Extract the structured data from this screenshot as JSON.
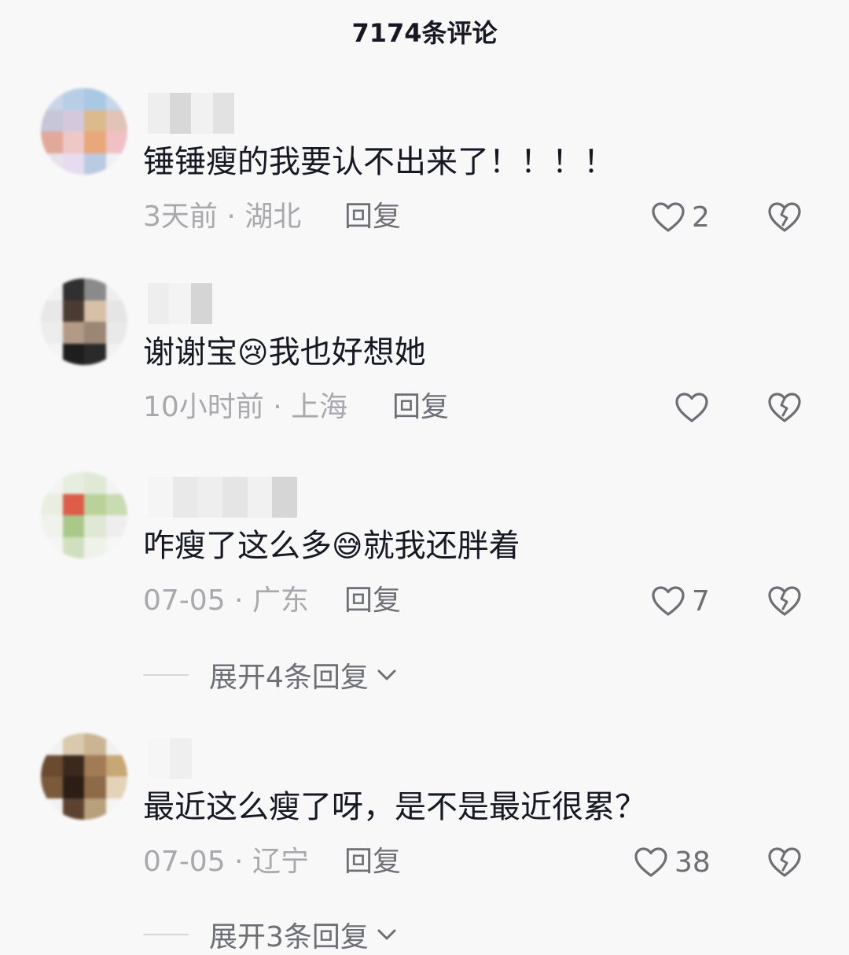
{
  "header": {
    "title": "7174条评论"
  },
  "comments": [
    {
      "text": "锤锤瘦的我要认不出来了！！！！",
      "time_location": "3天前 · 湖北",
      "reply_label": "回复",
      "like_count": "2"
    },
    {
      "text_before": "谢谢宝",
      "emoji": "😢",
      "text_after": "我也好想她",
      "time_location": "10小时前 · 上海",
      "reply_label": "回复",
      "like_count": ""
    },
    {
      "text_before": "咋瘦了这么多",
      "emoji": "😅",
      "text_after": "就我还胖着",
      "time_location": "07-05 · 广东",
      "reply_label": "回复",
      "like_count": "7",
      "expand_label": "展开4条回复"
    },
    {
      "text": "最近这么瘦了呀，是不是最近很累？",
      "time_location": "07-05 · 辽宁",
      "reply_label": "回复",
      "like_count": "38",
      "expand_label": "展开3条回复"
    }
  ],
  "icons": {
    "like": "heart-outline-icon",
    "dislike": "broken-heart-icon",
    "expand": "chevron-down-icon"
  },
  "colors": {
    "background": "#f8f8f8",
    "text": "#161823",
    "meta": "#a8a8ad",
    "secondary": "#6e6f75"
  }
}
